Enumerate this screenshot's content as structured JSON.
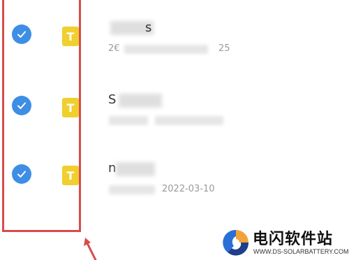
{
  "file_list": {
    "items": [
      {
        "checked": true,
        "file_icon": {
          "glyph": "T",
          "color": "#f0cf2e"
        },
        "title_visible": "s",
        "subtitle_visible_start": "2€",
        "subtitle_visible_end": "25"
      },
      {
        "checked": true,
        "file_icon": {
          "glyph": "T",
          "color": "#f0cf2e"
        },
        "title_visible": "S",
        "subtitle_visible_start": "",
        "subtitle_visible_end": ""
      },
      {
        "checked": true,
        "file_icon": {
          "glyph": "T",
          "color": "#f0cf2e"
        },
        "title_visible": "n",
        "subtitle_visible_start": "",
        "subtitle_visible_end": "2022-03-10"
      }
    ]
  },
  "colors": {
    "check_blue": "#3e8ee6",
    "file_icon_yellow": "#f0cf2e",
    "annotation_red": "#d94b4b"
  },
  "watermark": {
    "title": "电闪软件站",
    "url": "WWW.DS-SOLARBATTERY.COM"
  }
}
